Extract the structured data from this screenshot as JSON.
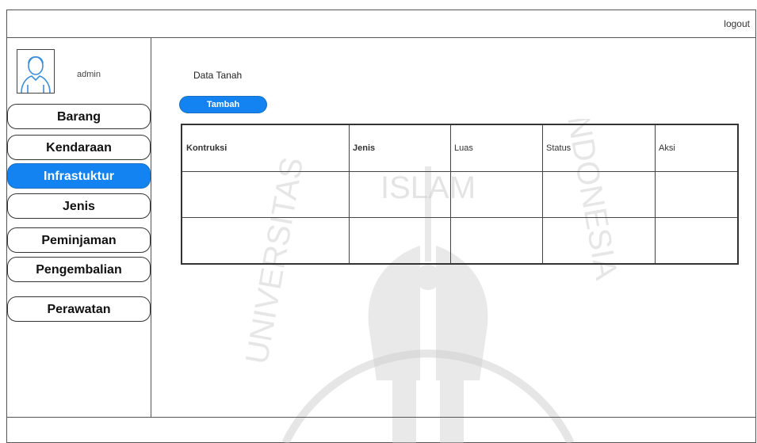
{
  "topbar": {
    "logout_label": "logout"
  },
  "user": {
    "name": "admin"
  },
  "sidebar": {
    "items": [
      {
        "label": "Barang",
        "active": false
      },
      {
        "label": "Kendaraan",
        "active": false
      },
      {
        "label": "Infrastuktur",
        "active": true
      },
      {
        "label": "Jenis",
        "active": false
      },
      {
        "label": "Peminjaman",
        "active": false
      },
      {
        "label": "Pengembalian",
        "active": false
      },
      {
        "label": "Perawatan",
        "active": false
      }
    ]
  },
  "main": {
    "title": "Data Tanah",
    "add_button_label": "Tambah",
    "table": {
      "headers": [
        "Kontruksi",
        "Jenis",
        "Luas",
        "Status",
        "Aksi"
      ],
      "header_bold": [
        true,
        true,
        false,
        false,
        false
      ],
      "rows": [
        [
          "",
          "",
          "",
          "",
          ""
        ],
        [
          "",
          "",
          "",
          "",
          ""
        ]
      ]
    }
  },
  "watermark": {
    "text_top": "ISLAM",
    "text_left": "UNIVERSITAS",
    "text_right": "INDONESIA"
  },
  "colors": {
    "accent": "#1283f0",
    "border": "#555555"
  }
}
